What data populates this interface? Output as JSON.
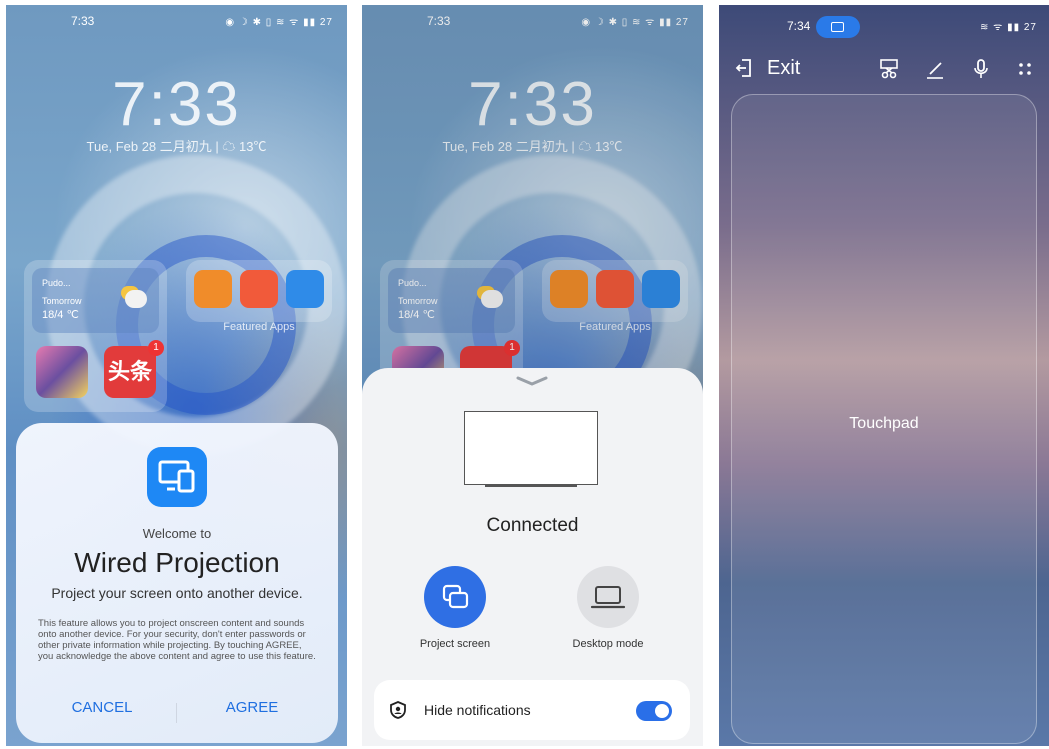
{
  "panel1": {
    "status_time": "7:33",
    "status_icons": "◉ ☽ ✱ ▯ ≋ ᯤ ▮▮ 27",
    "clock": "7:33",
    "date": "Tue, Feb 28  二月初九  |  ☁ 13℃",
    "weather": {
      "place": "Pudo...",
      "label": "Tomorrow",
      "temp": "18/4 ℃"
    },
    "badge_count": "1",
    "featured_label": "Featured Apps",
    "dialog": {
      "welcome": "Welcome to",
      "title": "Wired Projection",
      "subtitle": "Project your screen onto another device.",
      "body": "This feature allows you to project onscreen content and sounds onto another device. For your security, don't enter passwords or other private information while projecting. By touching AGREE, you acknowledge the above content and agree to use this feature.",
      "cancel": "CANCEL",
      "agree": "AGREE"
    }
  },
  "panel2": {
    "status_time": "7:33",
    "status_icons": "◉ ☽ ✱ ▯ ≋ ᯤ ▮▮ 27",
    "clock": "7:33",
    "date": "Tue, Feb 28  二月初九  |  ☁ 13℃",
    "weather": {
      "place": "Pudo...",
      "label": "Tomorrow",
      "temp": "18/4 ℃"
    },
    "badge_count": "1",
    "featured_label": "Featured Apps",
    "connected": "Connected",
    "project_screen": "Project screen",
    "desktop_mode": "Desktop mode",
    "hide_notifications": "Hide notifications"
  },
  "panel3": {
    "status_time": "7:34",
    "status_icons": "≋ ᯤ ▮▮ 27",
    "exit": "Exit",
    "touchpad": "Touchpad"
  }
}
